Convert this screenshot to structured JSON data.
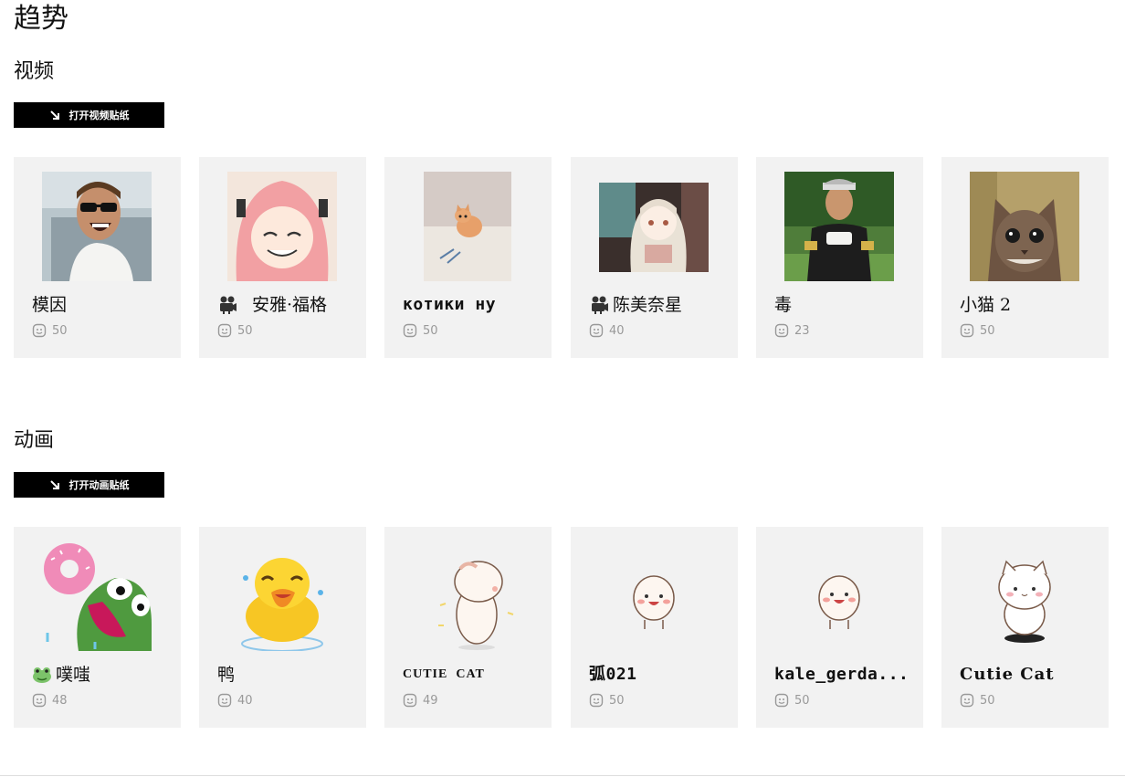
{
  "page": {
    "title": "趋势"
  },
  "video_section": {
    "title": "视频",
    "open_button": "打开视频贴纸",
    "cards": [
      {
        "name": "模因",
        "count": "50",
        "icon": "",
        "thumb": "man-sunglasses-laughing"
      },
      {
        "name": "安雅·福格",
        "count": "50",
        "icon": "movie-camera-icon",
        "thumb": "anime-girl-pink-hair"
      },
      {
        "name": "котики ну",
        "count": "50",
        "icon": "",
        "thumb": "kitten-on-bed"
      },
      {
        "name": "陈美奈星",
        "count": "40",
        "icon": "movie-camera-icon",
        "thumb": "anime-girl-white-hair"
      },
      {
        "name": "毒",
        "count": "23",
        "icon": "",
        "thumb": "man-drinking-cup"
      },
      {
        "name": "小猫 2",
        "count": "50",
        "icon": "",
        "thumb": "kitten-face"
      }
    ]
  },
  "animation_section": {
    "title": "动画",
    "open_button": "打开动画贴纸",
    "cards": [
      {
        "name": "噗嗤",
        "count": "48",
        "icon": "frog-icon",
        "thumb": "pepe-frog-donut"
      },
      {
        "name": "鸭",
        "count": "40",
        "icon": "",
        "thumb": "yellow-duck-laughing"
      },
      {
        "name": "CUTIE  CAT",
        "count": "49",
        "icon": "",
        "thumb": "white-bun-character"
      },
      {
        "name": "弧021",
        "count": "50",
        "icon": "",
        "thumb": "bun-character-smiling"
      },
      {
        "name": "kale_gerda...",
        "count": "50",
        "icon": "",
        "thumb": "bun-character-smiling-2"
      },
      {
        "name": "Cutie Cat",
        "count": "50",
        "icon": "",
        "thumb": "white-cat-cartoon"
      }
    ]
  },
  "colors": {
    "card_bg": "#f2f2f2",
    "button_bg": "#000000",
    "count_text": "#999999"
  }
}
